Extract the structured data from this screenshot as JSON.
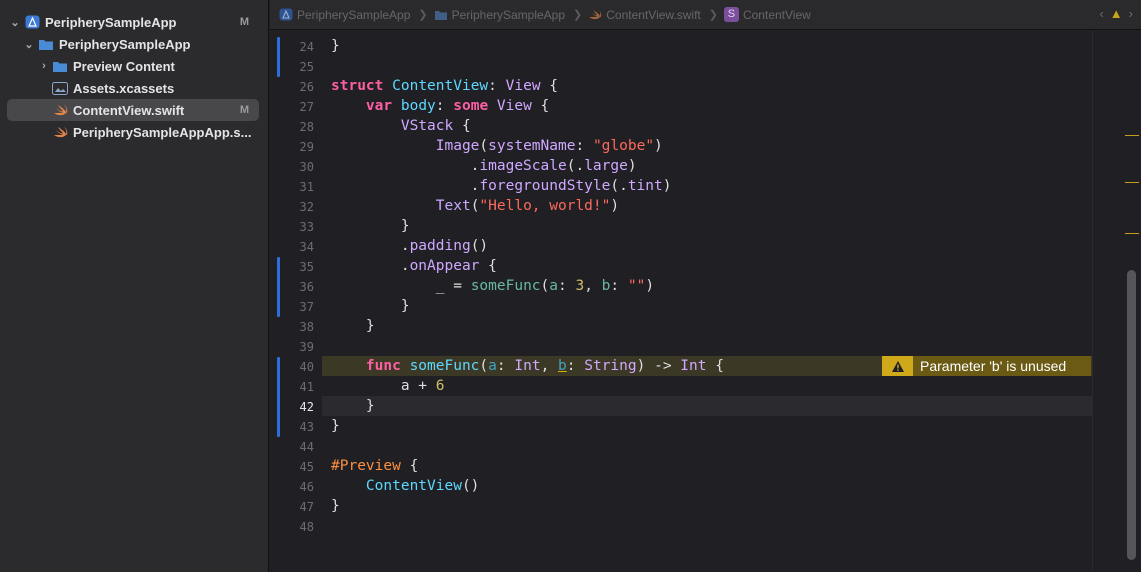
{
  "navigator": {
    "project": {
      "label": "PeripherySampleApp",
      "badge": "M"
    },
    "group": {
      "label": "PeripherySampleApp"
    },
    "items": [
      {
        "label": "Preview Content",
        "icon": "folder-icon"
      },
      {
        "label": "Assets.xcassets",
        "icon": "assets-icon"
      },
      {
        "label": "ContentView.swift",
        "badge": "M",
        "icon": "swift-file-icon"
      },
      {
        "label": "PeripherySampleAppApp.s...",
        "icon": "swift-file-icon"
      }
    ]
  },
  "jumpbar": {
    "crumbs": [
      "PeripherySampleApp",
      "PeripherySampleApp",
      "ContentView.swift",
      "ContentView"
    ],
    "symbol_letter": "S"
  },
  "editor": {
    "line_numbers": [
      "24",
      "25",
      "26",
      "27",
      "28",
      "29",
      "30",
      "31",
      "32",
      "33",
      "34",
      "35",
      "36",
      "37",
      "38",
      "39",
      "40",
      "41",
      "42",
      "43",
      "44",
      "45",
      "46",
      "47",
      "48"
    ],
    "current_line": "42",
    "warning": "Parameter 'b' is unused"
  },
  "colors": {
    "keyword": "#fc5fa3",
    "type": "#5dd8ff",
    "string": "#fc6a5d",
    "number": "#d0bf69",
    "warning": "#cfa91a",
    "change_bar": "#2d6fd8"
  }
}
